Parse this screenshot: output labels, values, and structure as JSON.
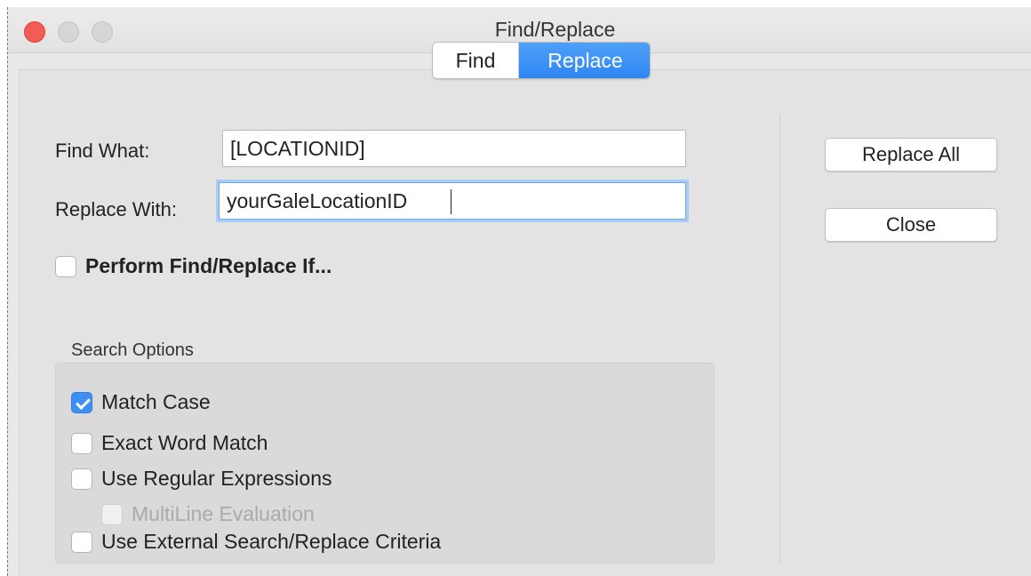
{
  "window": {
    "title": "Find/Replace"
  },
  "tabs": [
    {
      "label": "Find",
      "active": false
    },
    {
      "label": "Replace",
      "active": true
    }
  ],
  "find_what": {
    "label": "Find What:",
    "value": "[LOCATIONID]"
  },
  "replace_with": {
    "label": "Replace With:",
    "value": "yourGaleLocationID"
  },
  "perform_if": {
    "label": "Perform Find/Replace If...",
    "checked": false
  },
  "buttons": {
    "replace_all": "Replace All",
    "close": "Close"
  },
  "search_options": {
    "title": "Search Options",
    "match_case": {
      "label": "Match Case",
      "checked": true
    },
    "exact_word": {
      "label": "Exact Word Match",
      "checked": false
    },
    "regex": {
      "label": "Use Regular Expressions",
      "checked": false
    },
    "multiline": {
      "label": "MultiLine Evaluation",
      "checked": false,
      "enabled": false
    },
    "external": {
      "label": "Use External Search/Replace Criteria",
      "checked": false
    }
  },
  "colors": {
    "accent": "#2f86f2",
    "close_button": "#f45b55",
    "window_bg": "#e8e8e8"
  }
}
